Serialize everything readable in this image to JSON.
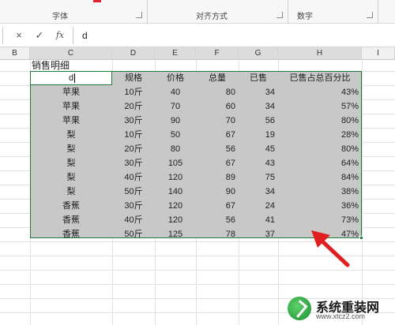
{
  "ribbon": {
    "groups": [
      "字体",
      "对齐方式",
      "数字"
    ]
  },
  "formula_bar": {
    "cancel_icon": "×",
    "confirm_icon": "✓",
    "fx_label": "fx",
    "value": "d"
  },
  "columns": [
    "B",
    "C",
    "D",
    "E",
    "F",
    "G",
    "H",
    "I"
  ],
  "sheet": {
    "title": "销售明细",
    "headers": [
      "d",
      "规格",
      "价格",
      "总量",
      "已售",
      "已售占总百分比"
    ],
    "rows": [
      [
        "苹果",
        "10斤",
        "40",
        "80",
        "34",
        "43%"
      ],
      [
        "苹果",
        "20斤",
        "70",
        "60",
        "34",
        "57%"
      ],
      [
        "苹果",
        "30斤",
        "90",
        "70",
        "56",
        "80%"
      ],
      [
        "梨",
        "10斤",
        "50",
        "67",
        "19",
        "28%"
      ],
      [
        "梨",
        "20斤",
        "80",
        "56",
        "45",
        "80%"
      ],
      [
        "梨",
        "30斤",
        "105",
        "67",
        "43",
        "64%"
      ],
      [
        "梨",
        "40斤",
        "120",
        "89",
        "75",
        "84%"
      ],
      [
        "梨",
        "50斤",
        "140",
        "90",
        "34",
        "38%"
      ],
      [
        "香蕉",
        "30斤",
        "120",
        "67",
        "24",
        "36%"
      ],
      [
        "香蕉",
        "40斤",
        "120",
        "56",
        "41",
        "73%"
      ],
      [
        "香蕉",
        "50斤",
        "125",
        "78",
        "37",
        "47%"
      ]
    ]
  },
  "annotation": {
    "arrow_color": "#e02020"
  },
  "watermark": {
    "name": "系统重装网",
    "url": "www.xtcz2.com"
  }
}
